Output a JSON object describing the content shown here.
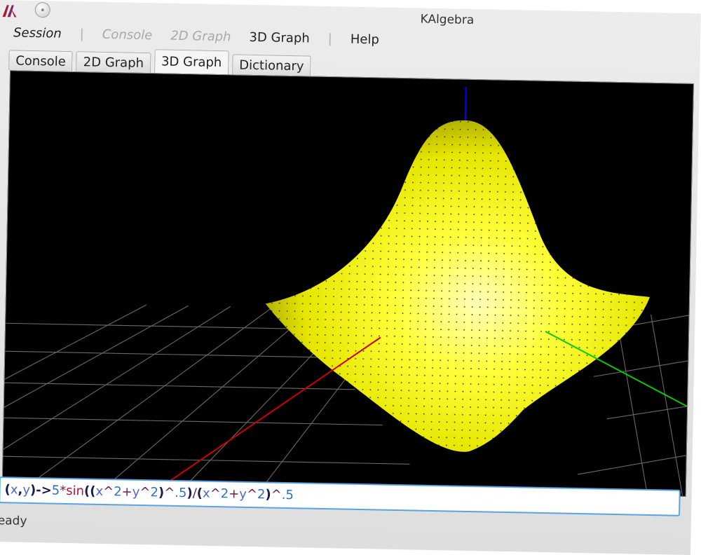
{
  "window": {
    "title": "KAlgebra"
  },
  "menu": [
    {
      "label": "Session",
      "state": "italic"
    },
    {
      "label": "|",
      "state": "separator"
    },
    {
      "label": "Console",
      "state": "disabled"
    },
    {
      "label": "2D Graph",
      "state": "disabled"
    },
    {
      "label": "3D Graph",
      "state": "normal"
    },
    {
      "label": "|",
      "state": "separator"
    },
    {
      "label": "Help",
      "state": "normal"
    }
  ],
  "tabs": [
    {
      "label": "Console"
    },
    {
      "label": "2D Graph"
    },
    {
      "label": "3D Graph",
      "active": true
    },
    {
      "label": "Dictionary"
    }
  ],
  "graph3d": {
    "background": "#000000",
    "surface_color": "#ffff00",
    "grid_color": "#6a6a6a",
    "axes": {
      "x": "#cc0000",
      "y": "#00cc00",
      "z": "#0000ff"
    }
  },
  "expression": {
    "text": "(x,y)->5*sin((x^2+y^2)^.5)/(x^2+y^2)^.5",
    "tokens": [
      {
        "t": "(",
        "c": "dark"
      },
      {
        "t": "x",
        "c": "var"
      },
      {
        "t": ",",
        "c": "dark"
      },
      {
        "t": "y",
        "c": "var"
      },
      {
        "t": ")",
        "c": "dark"
      },
      {
        "t": "->",
        "c": "dark"
      },
      {
        "t": "5",
        "c": "num"
      },
      {
        "t": "*",
        "c": "op"
      },
      {
        "t": "sin",
        "c": "fn"
      },
      {
        "t": "((",
        "c": "dark"
      },
      {
        "t": "x",
        "c": "var"
      },
      {
        "t": "^",
        "c": "op"
      },
      {
        "t": "2",
        "c": "num"
      },
      {
        "t": "+",
        "c": "op"
      },
      {
        "t": "y",
        "c": "var"
      },
      {
        "t": "^",
        "c": "op"
      },
      {
        "t": "2",
        "c": "num"
      },
      {
        "t": ")",
        "c": "dark"
      },
      {
        "t": "^",
        "c": "op"
      },
      {
        "t": ".5",
        "c": "num"
      },
      {
        "t": ")",
        "c": "dark"
      },
      {
        "t": "/",
        "c": "op"
      },
      {
        "t": "(",
        "c": "dark"
      },
      {
        "t": "x",
        "c": "var"
      },
      {
        "t": "^",
        "c": "op"
      },
      {
        "t": "2",
        "c": "num"
      },
      {
        "t": "+",
        "c": "op"
      },
      {
        "t": "y",
        "c": "var"
      },
      {
        "t": "^",
        "c": "op"
      },
      {
        "t": "2",
        "c": "num"
      },
      {
        "t": ")",
        "c": "dark"
      },
      {
        "t": "^",
        "c": "op"
      },
      {
        "t": ".5",
        "c": "num"
      }
    ]
  },
  "status": {
    "text": "Ready"
  }
}
